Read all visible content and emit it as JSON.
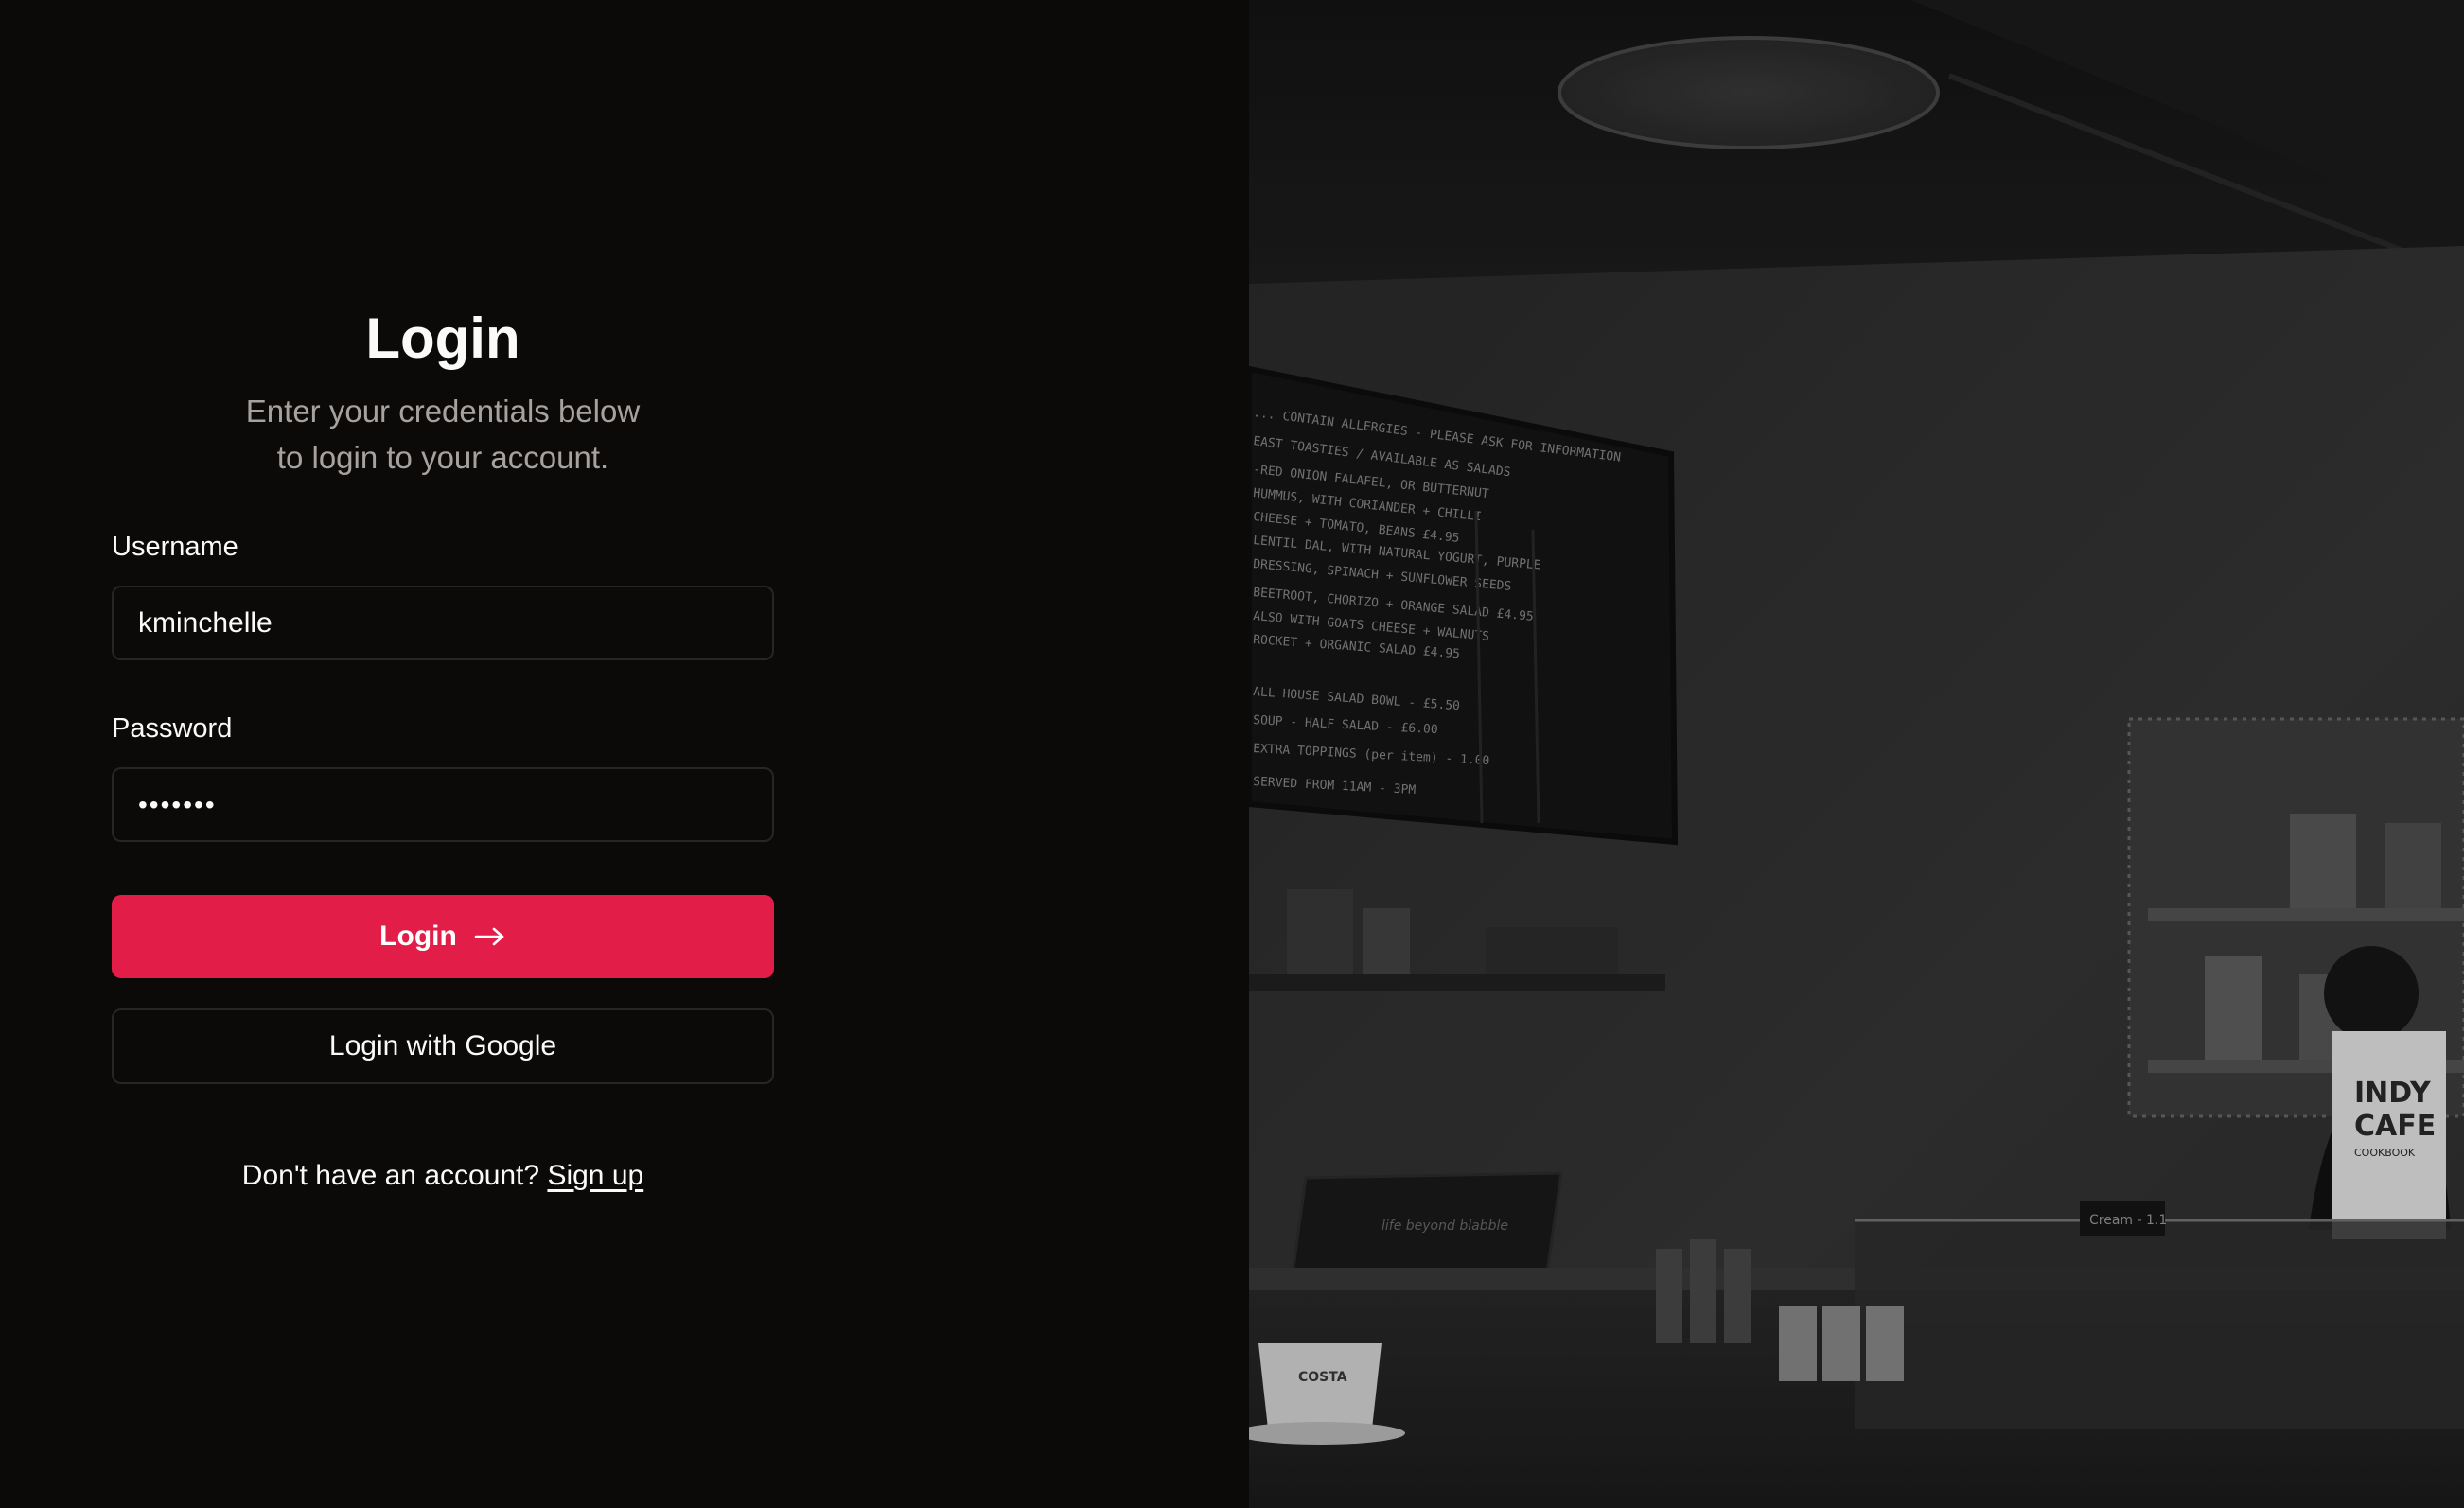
{
  "login": {
    "title": "Login",
    "subtitle_line1": "Enter your credentials below",
    "subtitle_line2": "to login to your account.",
    "username": {
      "label": "Username",
      "value": "kminchelle"
    },
    "password": {
      "label": "Password",
      "value": "•••••••"
    },
    "submit_label": "Login",
    "submit_icon": "arrow-right-icon",
    "google_label": "Login with Google",
    "signup_prompt": "Don't have an account?",
    "signup_link": "Sign up"
  },
  "photo": {
    "book_cover_line1": "INDY",
    "book_cover_line2": "CAFE",
    "book_cover_line3": "COOKBOOK",
    "cup_text": "COSTA",
    "register_text": "life beyond blabble",
    "sign_text": "Cream - 1.1",
    "board_lines": [
      "... CONTAIN ALLERGIES - PLEASE ASK FOR INFORMATION",
      "EAST TOASTIES / AVAILABLE AS SALADS",
      "-RED ONION FALAFEL, OR BUTTERNUT",
      "HUMMUS, WITH CORIANDER + CHILLI",
      "CHEESE + TOMATO, BEANS  £4.95",
      "LENTIL DAL, WITH NATURAL YOGURT, PURPLE",
      "DRESSING, SPINACH + SUNFLOWER SEEDS",
      "BEETROOT, CHORIZO + ORANGE SALAD  £4.95",
      "ALSO WITH GOATS CHEESE + WALNUTS",
      "ROCKET + ORGANIC SALAD  £4.95",
      "ALL HOUSE SALAD BOWL - £5.50",
      "SOUP - HALF SALAD - £6.00",
      "EXTRA TOPPINGS (per item) - 1.00",
      "SERVED FROM 11AM - 3PM"
    ]
  },
  "colors": {
    "background": "#0c0a09",
    "accent": "#e11d48",
    "border": "#292524",
    "muted_text": "#a8a29e"
  }
}
